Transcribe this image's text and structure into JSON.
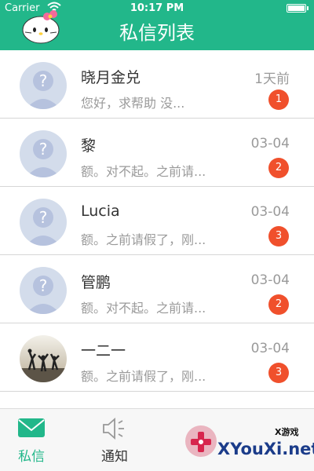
{
  "status_bar": {
    "carrier": "Carrier",
    "time": "10:17 PM"
  },
  "header": {
    "title": "私信列表"
  },
  "messages": [
    {
      "name": "晓月金兑",
      "preview": "您好，求帮助 没...",
      "date": "1天前",
      "unread": "1"
    },
    {
      "name": "黎",
      "preview": "额。对不起。之前请...",
      "date": "03-04",
      "unread": "2"
    },
    {
      "name": "Lucia",
      "preview": "额。之前请假了，刚...",
      "date": "03-04",
      "unread": "3"
    },
    {
      "name": "管鹏",
      "preview": "额。对不起。之前请...",
      "date": "03-04",
      "unread": "2"
    },
    {
      "name": "一二一",
      "preview": "额。之前请假了，刚...",
      "date": "03-04",
      "unread": "3"
    }
  ],
  "tabs": [
    {
      "label": "私信",
      "icon": "mail-icon",
      "active": true
    },
    {
      "label": "通知",
      "icon": "speaker-icon",
      "active": false
    }
  ],
  "watermark": {
    "text": "XYouXi.net",
    "small": "X游戏"
  },
  "colors": {
    "accent": "#22b78a",
    "badge": "#f0502c",
    "muted": "#9a9a9a",
    "text": "#333333"
  }
}
